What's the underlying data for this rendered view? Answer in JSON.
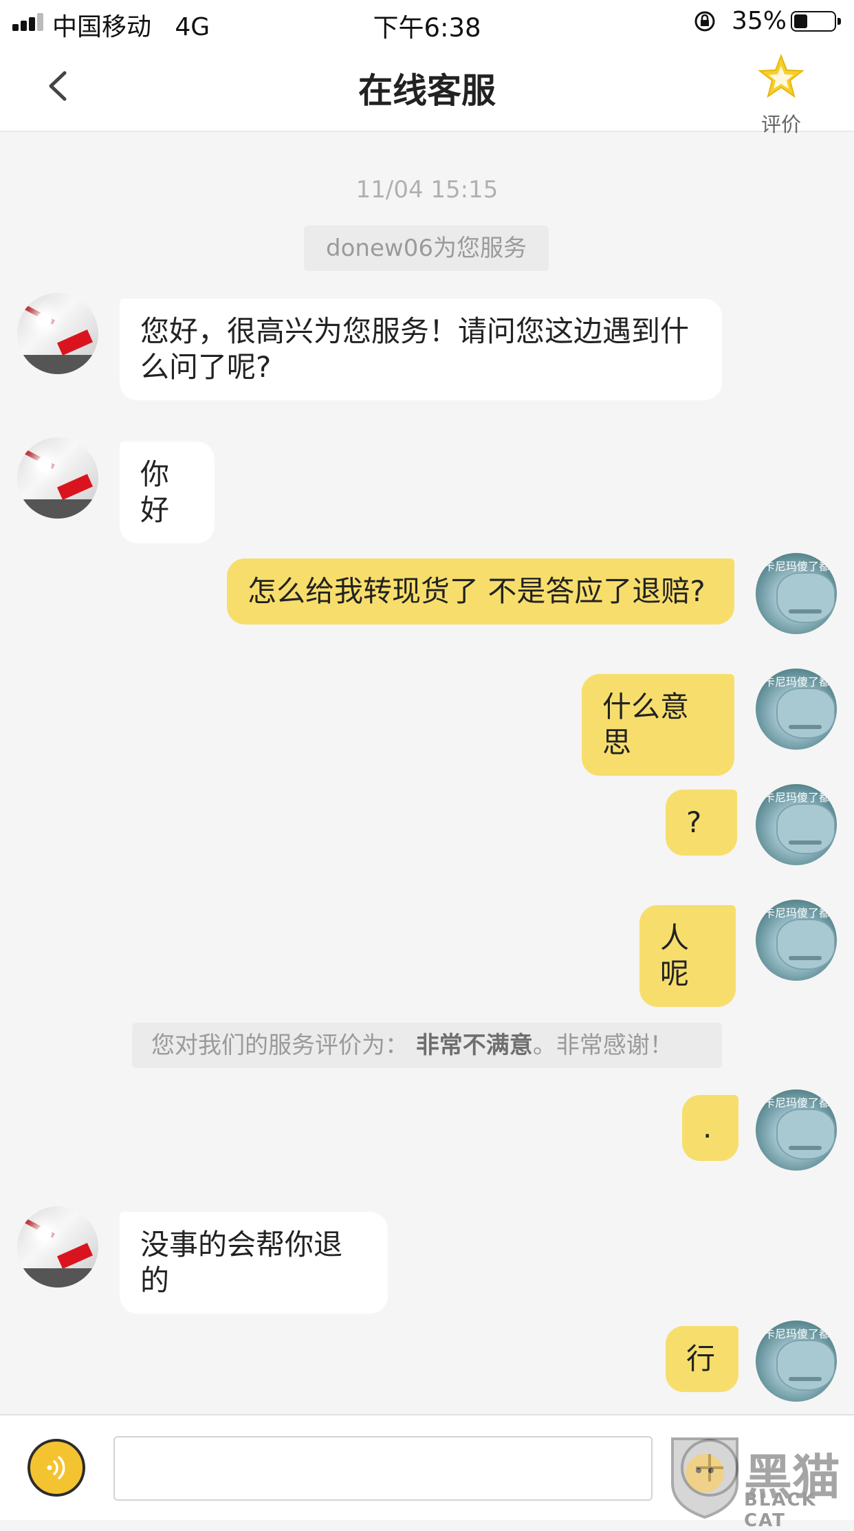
{
  "status_bar": {
    "carrier": "中国移动",
    "network": "4G",
    "time": "下午6:38",
    "battery_percent": "35%",
    "battery_level": 0.35
  },
  "nav": {
    "title": "在线客服",
    "rate_label": "评价",
    "back_icon": "chevron-left-icon",
    "rate_icon": "star-icon"
  },
  "chat": {
    "timestamp": "11/04 15:15",
    "agent_banner": "donew06为您服务",
    "messages": [
      {
        "from": "agent",
        "text": "您好，很高兴为您服务！请问您这边遇到什么问了呢?"
      },
      {
        "from": "agent",
        "text": "你好"
      },
      {
        "from": "user",
        "text": "怎么给我转现货了 不是答应了退赔?"
      },
      {
        "from": "user",
        "text": "什么意思"
      },
      {
        "from": "user",
        "text": "?"
      },
      {
        "from": "user",
        "text": "人呢"
      },
      {
        "from": "user",
        "text": "."
      },
      {
        "from": "agent",
        "text": "没事的会帮你退的"
      },
      {
        "from": "user",
        "text": "行"
      }
    ],
    "rating_notice": {
      "prefix": "您对我们的服务评价为：",
      "rating": "非常不满意",
      "suffix": "。非常感谢！"
    },
    "agent_avatar_logo": "Supreme",
    "user_avatar_caption": "卡尼玛傻了都"
  },
  "input_bar": {
    "voice_icon": "voice-icon",
    "text_value": "",
    "add_icon": "plus-icon"
  },
  "watermark": {
    "text": "BLACK CAT",
    "big": "黑猫"
  },
  "colors": {
    "user_bubble": "#f7de6c",
    "agent_bubble": "#ffffff",
    "background": "#f5f5f5",
    "accent": "#f4c330"
  }
}
